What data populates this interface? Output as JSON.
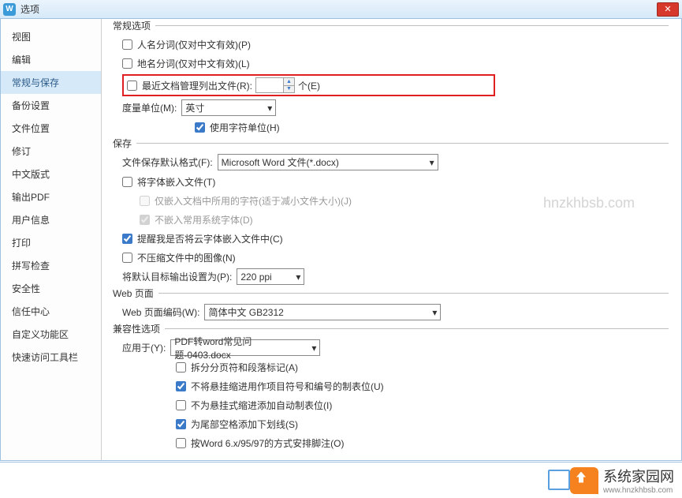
{
  "window": {
    "title": "选项",
    "app_icon_letter": "W"
  },
  "sidebar": {
    "items": [
      {
        "label": "视图"
      },
      {
        "label": "编辑"
      },
      {
        "label": "常规与保存",
        "active": true
      },
      {
        "label": "备份设置"
      },
      {
        "label": "文件位置"
      },
      {
        "label": "修订"
      },
      {
        "label": "中文版式"
      },
      {
        "label": "输出PDF"
      },
      {
        "label": "用户信息"
      },
      {
        "label": "打印"
      },
      {
        "label": "拼写检查"
      },
      {
        "label": "安全性"
      },
      {
        "label": "信任中心"
      },
      {
        "label": "自定义功能区"
      },
      {
        "label": "快速访问工具栏"
      }
    ]
  },
  "sections": {
    "general": {
      "title": "常规选项",
      "person_name_split": "人名分词(仅对中文有效)(P)",
      "place_name_split": "地名分词(仅对中文有效)(L)",
      "recent_files_label": "最近文档管理列出文件(R):",
      "recent_files_value": "",
      "recent_files_unit": "个(E)",
      "measure_unit_label": "度量单位(M):",
      "measure_unit_value": "英寸",
      "use_char_unit": "使用字符单位(H)"
    },
    "save": {
      "title": "保存",
      "default_format_label": "文件保存默认格式(F):",
      "default_format_value": "Microsoft Word 文件(*.docx)",
      "embed_fonts": "将字体嵌入文件(T)",
      "embed_only_used": "仅嵌入文档中所用的字符(适于减小文件大小)(J)",
      "no_embed_system": "不嵌入常用系统字体(D)",
      "remind_cloud_fonts": "提醒我是否将云字体嵌入文件中(C)",
      "no_compress_images": "不压缩文件中的图像(N)",
      "default_output_label": "将默认目标输出设置为(P):",
      "default_output_value": "220 ppi"
    },
    "web": {
      "title": "Web 页面",
      "encoding_label": "Web 页面编码(W):",
      "encoding_value": "简体中文 GB2312"
    },
    "compat": {
      "title": "兼容性选项",
      "apply_to_label": "应用于(Y):",
      "apply_to_value": "PDF转word常见问题-0403.docx",
      "split_pagebreak": "拆分分页符和段落标记(A)",
      "no_hang_indent_tab": "不将悬挂缩进用作项目符号和编号的制表位(U)",
      "no_hang_indent_auto": "不为悬挂式缩进添加自动制表位(I)",
      "tail_space_underline": "为尾部空格添加下划线(S)",
      "word6_footnote": "按Word 6.x/95/97的方式安排脚注(O)"
    }
  },
  "watermark": "hnzkhbsb.com",
  "brand": {
    "text": "系统家园网",
    "url": "www.hnzkhbsb.com"
  }
}
